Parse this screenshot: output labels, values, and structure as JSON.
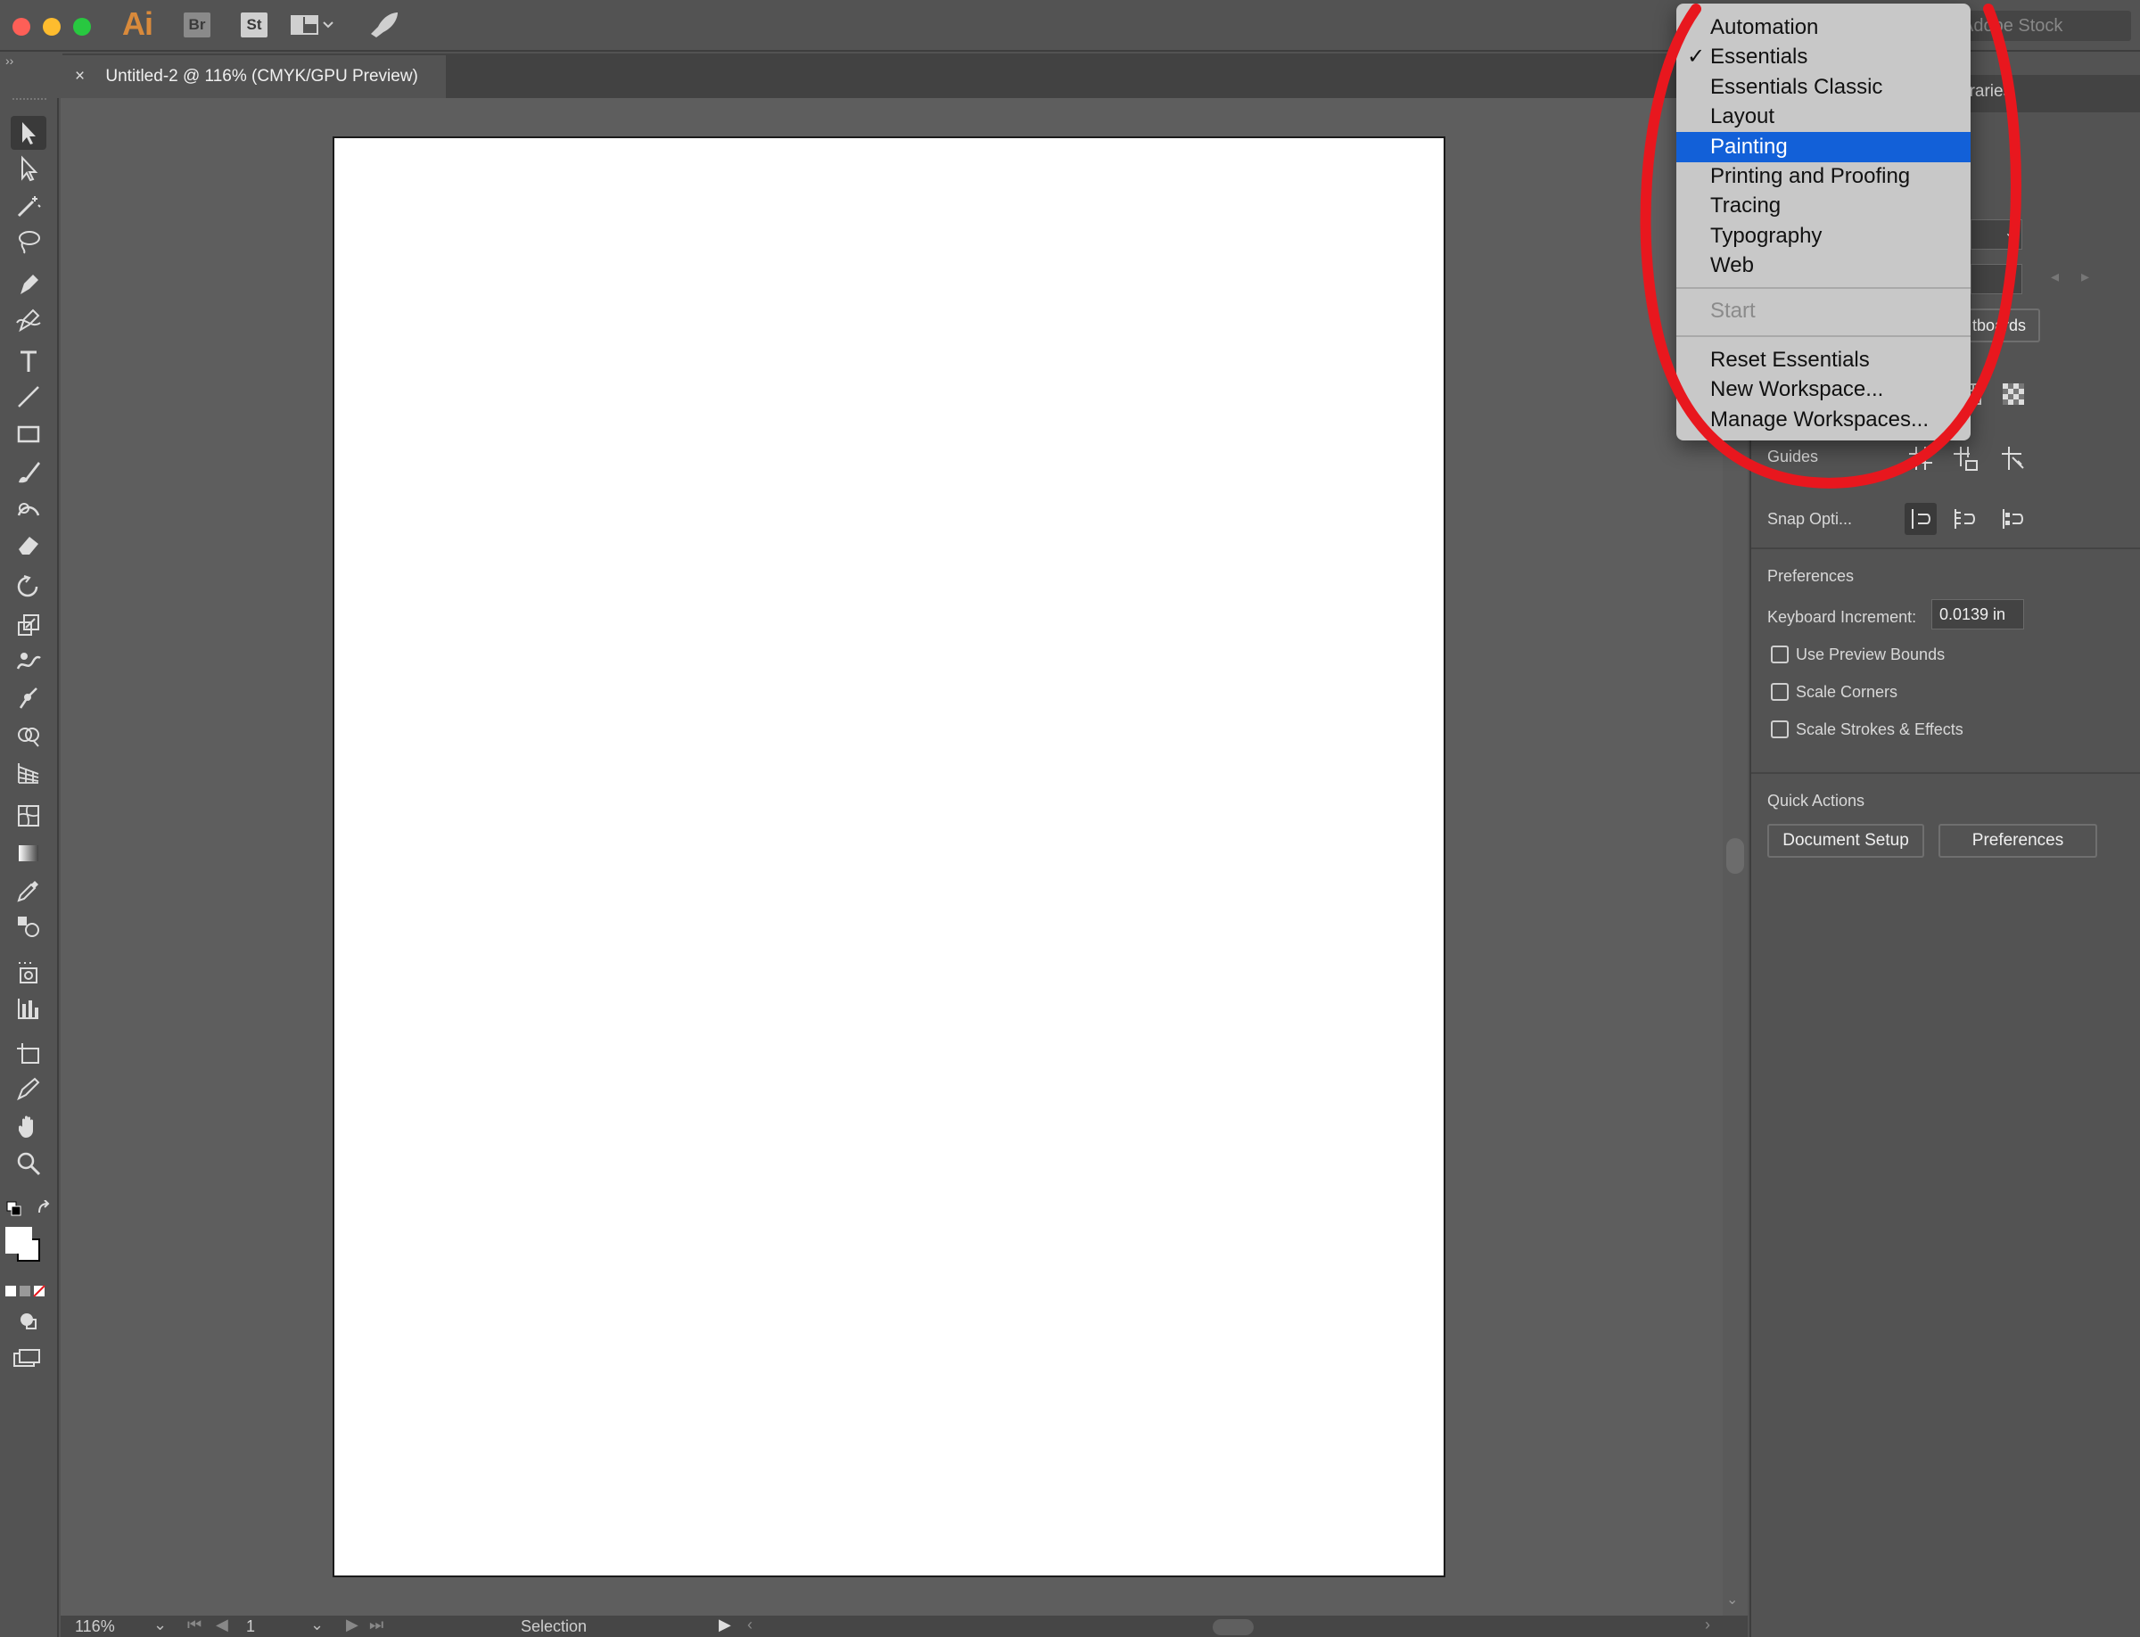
{
  "app": {
    "logo": "Ai",
    "bridge_badge": "Br",
    "stock_badge": "St",
    "search_placeholder": "Adobe Stock",
    "colors": {
      "accent": "#1260d8",
      "logo": "#d98a3b",
      "annotation": "#e8171e"
    }
  },
  "document_tab": {
    "close": "×",
    "title": "Untitled-2 @ 116% (CMYK/GPU Preview)"
  },
  "toolbar": {
    "tools": [
      "selection-tool-icon",
      "direct-selection-tool-icon",
      "magic-wand-icon",
      "lasso-icon",
      "pen-icon",
      "curvature-icon",
      "type-icon",
      "line-segment-icon",
      "rectangle-icon",
      "paintbrush-icon",
      "shaper-icon",
      "eraser-icon",
      "rotate-icon",
      "scale-icon",
      "warp-icon",
      "puppet-warp-icon",
      "shape-builder-icon",
      "perspective-grid-icon",
      "mesh-icon",
      "gradient-icon",
      "eyedropper-icon",
      "blend-icon",
      "symbol-sprayer-icon",
      "column-graph-icon",
      "artboard-icon",
      "slice-icon",
      "hand-icon",
      "zoom-icon"
    ]
  },
  "workspace_menu": {
    "items": [
      {
        "label": "Automation",
        "checked": false,
        "highlighted": false
      },
      {
        "label": "Essentials",
        "checked": true,
        "highlighted": false
      },
      {
        "label": "Essentials Classic",
        "checked": false,
        "highlighted": false
      },
      {
        "label": "Layout",
        "checked": false,
        "highlighted": false
      },
      {
        "label": "Painting",
        "checked": false,
        "highlighted": true
      },
      {
        "label": "Printing and Proofing",
        "checked": false,
        "highlighted": false
      },
      {
        "label": "Tracing",
        "checked": false,
        "highlighted": false
      },
      {
        "label": "Typography",
        "checked": false,
        "highlighted": false
      },
      {
        "label": "Web",
        "checked": false,
        "highlighted": false
      }
    ],
    "start": "Start",
    "actions": [
      "Reset Essentials",
      "New Workspace...",
      "Manage Workspaces..."
    ],
    "checkmark": "✓"
  },
  "properties_panel": {
    "tab_partial": "braries",
    "artboards_partial": "tboards",
    "guides_label": "Guides",
    "snap_label_partial": "Snap Opti...",
    "preferences_heading": "Preferences",
    "keyboard_increment_label": "Keyboard Increment:",
    "keyboard_increment_value": "0.0139 in",
    "use_preview_bounds": "Use Preview Bounds",
    "scale_corners": "Scale Corners",
    "scale_strokes": "Scale Strokes & Effects",
    "quick_actions_heading": "Quick Actions",
    "document_setup_button": "Document Setup",
    "preferences_button": "Preferences"
  },
  "statusbar": {
    "zoom": "116%",
    "artboard_number": "1",
    "mode": "Selection"
  }
}
